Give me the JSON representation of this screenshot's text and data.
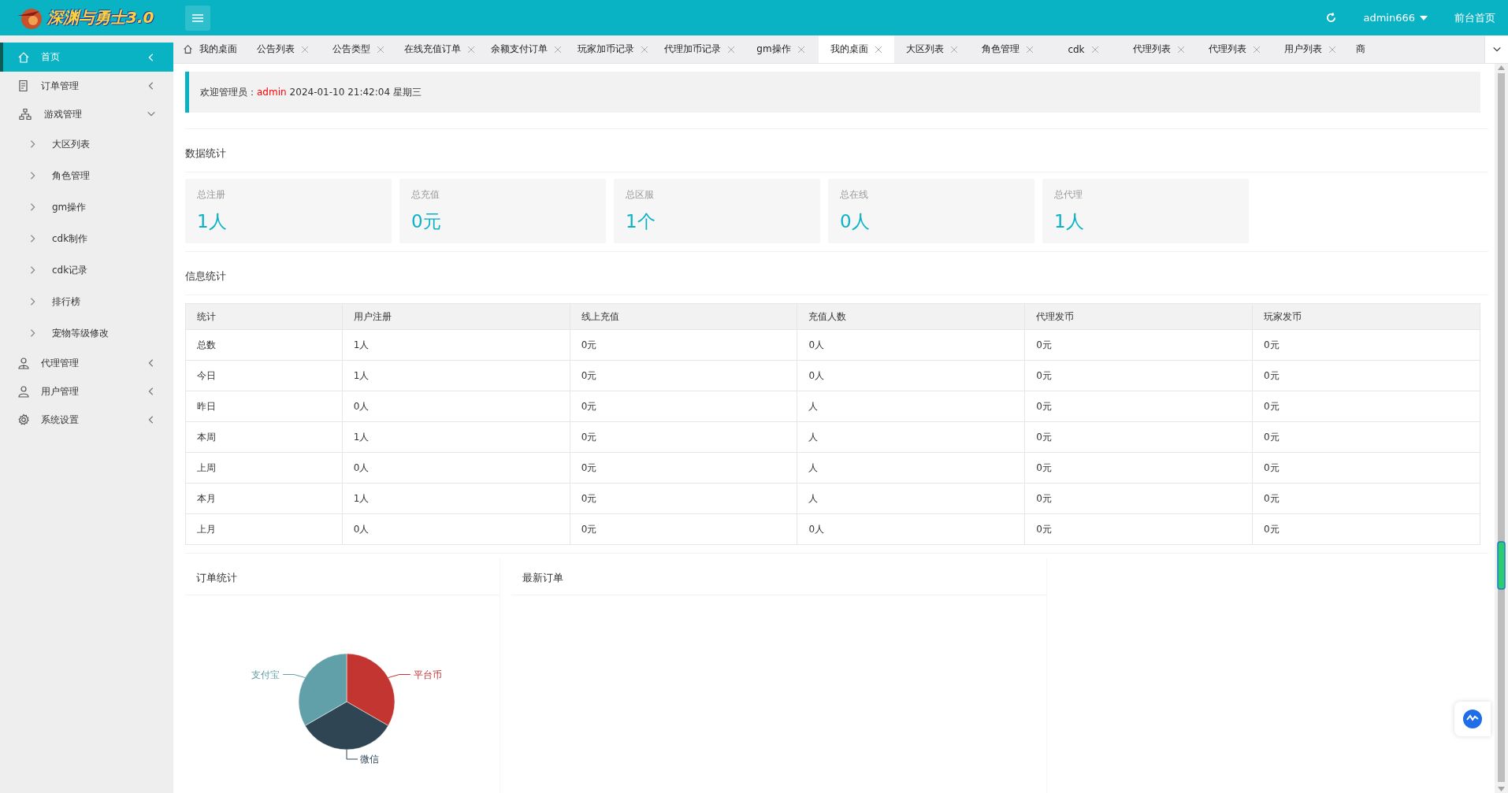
{
  "header": {
    "logo": "深渊与勇士3.0",
    "user": "admin666",
    "frontend_link": "前台首页"
  },
  "sidebar": {
    "items": [
      {
        "label": "首页",
        "selected": true,
        "expanded": false
      },
      {
        "label": "订单管理",
        "selected": false,
        "expanded": false
      },
      {
        "label": "游戏管理",
        "selected": false,
        "expanded": true,
        "children": [
          {
            "label": "大区列表"
          },
          {
            "label": "角色管理"
          },
          {
            "label": "gm操作"
          },
          {
            "label": "cdk制作"
          },
          {
            "label": "cdk记录"
          },
          {
            "label": "排行榜"
          },
          {
            "label": "宠物等级修改"
          }
        ]
      },
      {
        "label": "代理管理",
        "selected": false,
        "expanded": false
      },
      {
        "label": "用户管理",
        "selected": false,
        "expanded": false
      },
      {
        "label": "系统设置",
        "selected": false,
        "expanded": false
      }
    ]
  },
  "tabs": [
    {
      "label": "我的桌面",
      "kind": "home",
      "selected": false
    },
    {
      "label": "公告列表",
      "kind": "closable",
      "selected": false
    },
    {
      "label": "公告类型",
      "kind": "closable",
      "selected": false
    },
    {
      "label": "在线充值订单",
      "kind": "closable",
      "selected": false
    },
    {
      "label": "余额支付订单",
      "kind": "closable",
      "selected": false
    },
    {
      "label": "玩家加币记录",
      "kind": "closable",
      "selected": false
    },
    {
      "label": "代理加币记录",
      "kind": "closable",
      "selected": false
    },
    {
      "label": "gm操作",
      "kind": "closable",
      "selected": false
    },
    {
      "label": "我的桌面",
      "kind": "closable",
      "selected": true
    },
    {
      "label": "大区列表",
      "kind": "closable",
      "selected": false
    },
    {
      "label": "角色管理",
      "kind": "closable",
      "selected": false
    },
    {
      "label": "cdk",
      "kind": "closable",
      "selected": false
    },
    {
      "label": "代理列表",
      "kind": "closable",
      "selected": false
    },
    {
      "label": "代理列表",
      "kind": "closable",
      "selected": false
    },
    {
      "label": "用户列表",
      "kind": "closable",
      "selected": false
    },
    {
      "label": "商",
      "kind": "cut",
      "selected": false
    }
  ],
  "welcome": {
    "greeting": "欢迎管理员：",
    "user": "admin",
    "datetime": "2024-01-10  21:42:04  星期三"
  },
  "data_stats": {
    "title": "数据统计",
    "cards": [
      {
        "label": "总注册",
        "value": "1人"
      },
      {
        "label": "总充值",
        "value": "0元"
      },
      {
        "label": "总区服",
        "value": "1个"
      },
      {
        "label": "总在线",
        "value": "0人"
      },
      {
        "label": "总代理",
        "value": "1人"
      }
    ]
  },
  "info_stats": {
    "title": "信息统计",
    "columns": [
      "统计",
      "用户注册",
      "线上充值",
      "充值人数",
      "代理发币",
      "玩家发币"
    ],
    "rows": [
      [
        "总数",
        "1人",
        "0元",
        "0人",
        "0元",
        "0元"
      ],
      [
        "今日",
        "1人",
        "0元",
        "0人",
        "0元",
        "0元"
      ],
      [
        "昨日",
        "0人",
        "0元",
        "人",
        "0元",
        "0元"
      ],
      [
        "本周",
        "1人",
        "0元",
        "人",
        "0元",
        "0元"
      ],
      [
        "上周",
        "0人",
        "0元",
        "人",
        "0元",
        "0元"
      ],
      [
        "本月",
        "1人",
        "0元",
        "人",
        "0元",
        "0元"
      ],
      [
        "上月",
        "0人",
        "0元",
        "0人",
        "0元",
        "0元"
      ]
    ]
  },
  "order_stats": {
    "title": "订单统计",
    "slices": [
      {
        "label": "平台币",
        "color": "#c23531"
      },
      {
        "label": "微信",
        "color": "#2f4554"
      },
      {
        "label": "支付宝",
        "color": "#61a0a8"
      }
    ]
  },
  "latest_orders": {
    "title": "最新订单"
  }
}
